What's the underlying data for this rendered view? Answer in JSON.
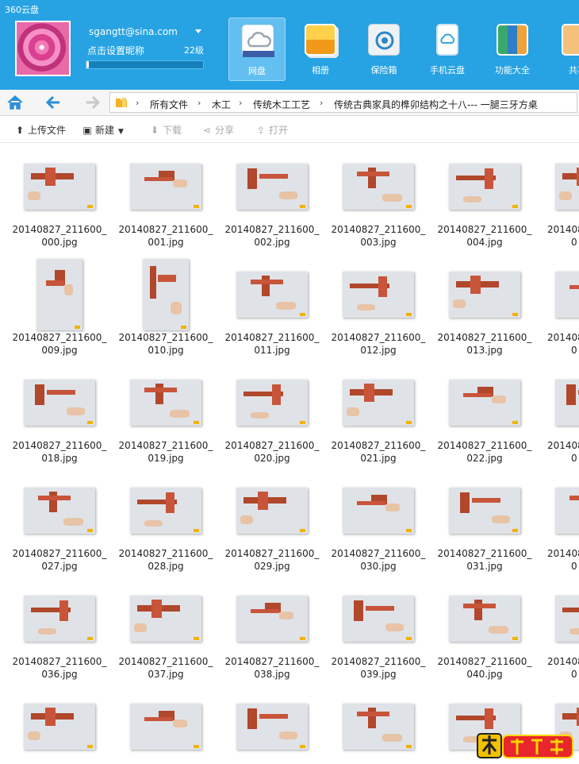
{
  "app": {
    "title": "360云盘"
  },
  "user": {
    "email": "sgangtt@sina.com",
    "nickname_prompt": "点击设置昵称",
    "level": "22级",
    "level_progress": 0.02
  },
  "nav": [
    {
      "label": "网盘",
      "icon": "cloud-disk-icon",
      "active": true
    },
    {
      "label": "相册",
      "icon": "photo-album-icon"
    },
    {
      "label": "保险箱",
      "icon": "safe-icon"
    },
    {
      "label": "手机云盘",
      "icon": "phone-cloud-icon"
    },
    {
      "label": "功能大全",
      "icon": "app-store-icon"
    },
    {
      "label": "共享",
      "icon": "share-folder-icon"
    }
  ],
  "breadcrumb": [
    "所有文件",
    "木工",
    "传统木工工艺",
    "传统古典家具的榫卯结构之十八--- 一腿三牙方桌"
  ],
  "toolbar": {
    "upload": "上传文件",
    "new": "新建",
    "download": "下载",
    "share": "分享",
    "open": "打开"
  },
  "files": [
    [
      "20140827_211600_",
      "000.jpg"
    ],
    [
      "20140827_211600_",
      "001.jpg"
    ],
    [
      "20140827_211600_",
      "002.jpg"
    ],
    [
      "20140827_211600_",
      "003.jpg"
    ],
    [
      "20140827_211600_",
      "004.jpg"
    ],
    [
      "201408",
      "0"
    ],
    [
      "20140827_211600_",
      "009.jpg"
    ],
    [
      "20140827_211600_",
      "010.jpg"
    ],
    [
      "20140827_211600_",
      "011.jpg"
    ],
    [
      "20140827_211600_",
      "012.jpg"
    ],
    [
      "20140827_211600_",
      "013.jpg"
    ],
    [
      "201408",
      "0"
    ],
    [
      "20140827_211600_",
      "018.jpg"
    ],
    [
      "20140827_211600_",
      "019.jpg"
    ],
    [
      "20140827_211600_",
      "020.jpg"
    ],
    [
      "20140827_211600_",
      "021.jpg"
    ],
    [
      "20140827_211600_",
      "022.jpg"
    ],
    [
      "201408",
      "0"
    ],
    [
      "20140827_211600_",
      "027.jpg"
    ],
    [
      "20140827_211600_",
      "028.jpg"
    ],
    [
      "20140827_211600_",
      "029.jpg"
    ],
    [
      "20140827_211600_",
      "030.jpg"
    ],
    [
      "20140827_211600_",
      "031.jpg"
    ],
    [
      "201408",
      "0"
    ],
    [
      "20140827_211600_",
      "036.jpg"
    ],
    [
      "20140827_211600_",
      "037.jpg"
    ],
    [
      "20140827_211600_",
      "038.jpg"
    ],
    [
      "20140827_211600_",
      "039.jpg"
    ],
    [
      "20140827_211600_",
      "040.jpg"
    ],
    [
      "201408",
      "0"
    ],
    [
      "",
      ""
    ],
    [
      "",
      ""
    ],
    [
      "",
      ""
    ],
    [
      "",
      ""
    ],
    [
      "",
      ""
    ],
    [
      "",
      ""
    ]
  ],
  "watermark": {
    "text": "爱好者",
    "mark": "木工"
  }
}
